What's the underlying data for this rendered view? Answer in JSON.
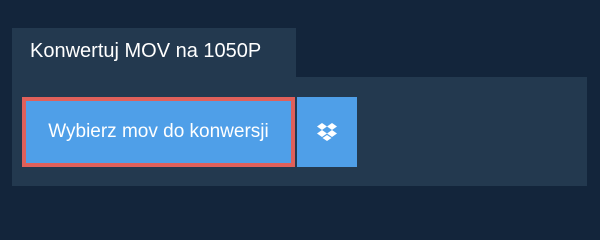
{
  "tab": {
    "title": "Konwertuj MOV na 1050P"
  },
  "upload": {
    "choose_label": "Wybierz mov do konwersji",
    "dropbox_icon": "dropbox-icon"
  },
  "colors": {
    "page_bg": "#13253b",
    "panel_bg": "#23394f",
    "button_bg": "#4f9fe8",
    "focus_border": "#e0605a",
    "text": "#ffffff"
  }
}
